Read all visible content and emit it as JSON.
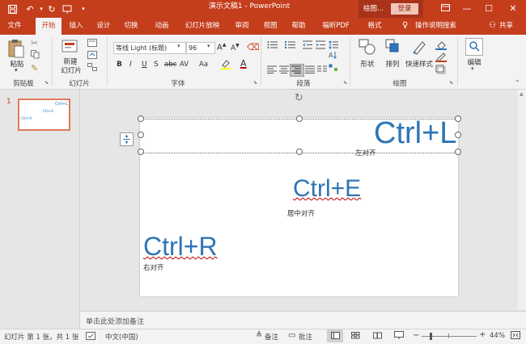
{
  "title_bar": {
    "document_title": "演示文稿1  -  PowerPoint",
    "context_group": "绘图...",
    "login_label": "登录",
    "quick_access": [
      "save-icon",
      "undo-icon",
      "redo-icon",
      "customize-icon"
    ],
    "window_controls": [
      "ribbon-display-icon",
      "minimize-icon",
      "restore-icon",
      "close-icon"
    ]
  },
  "tabs": [
    {
      "label": "文件"
    },
    {
      "label": "开始"
    },
    {
      "label": "插入"
    },
    {
      "label": "设计"
    },
    {
      "label": "切换"
    },
    {
      "label": "动画"
    },
    {
      "label": "幻灯片放映"
    },
    {
      "label": "审阅"
    },
    {
      "label": "视图"
    },
    {
      "label": "帮助"
    },
    {
      "label": "福昕PDF"
    },
    {
      "label": "格式"
    }
  ],
  "tell_me": "操作说明搜索",
  "share": "共享",
  "ribbon": {
    "clipboard": {
      "paste": "粘贴",
      "group": "剪贴板"
    },
    "slides": {
      "new_slide": "新建",
      "new_slide_line2": "幻灯片",
      "group": "幻灯片"
    },
    "font": {
      "name": "等线 Light (标题)",
      "size": "96",
      "group": "字体",
      "buttons": [
        "B",
        "I",
        "U",
        "S",
        "abc",
        "AV",
        "Aa"
      ]
    },
    "paragraph": {
      "group": "段落"
    },
    "drawing": {
      "shape": "形状",
      "arrange": "排列",
      "quick_styles": "快速样式",
      "group": "绘图"
    },
    "editing": {
      "label": "编辑"
    }
  },
  "thumbnail": {
    "number": "1",
    "texts": [
      "Ctrl+L",
      "Ctrl+E",
      "Ctrl+R"
    ]
  },
  "slide": {
    "top_right": "Ctrl+L",
    "top_right_caption": "左对齐",
    "center": "Ctrl+E",
    "center_caption": "居中对齐",
    "left": "Ctrl+R",
    "left_caption": "右对齐"
  },
  "notes_placeholder": "单击此处添加备注",
  "status": {
    "slide_info": "幻灯片 第 1 张，共 1 张",
    "language": "中文(中国)",
    "notes": "备注",
    "comments": "批注",
    "zoom": "44%"
  },
  "colors": {
    "accent": "#c43e1c",
    "text_blue": "#2e75b6"
  }
}
